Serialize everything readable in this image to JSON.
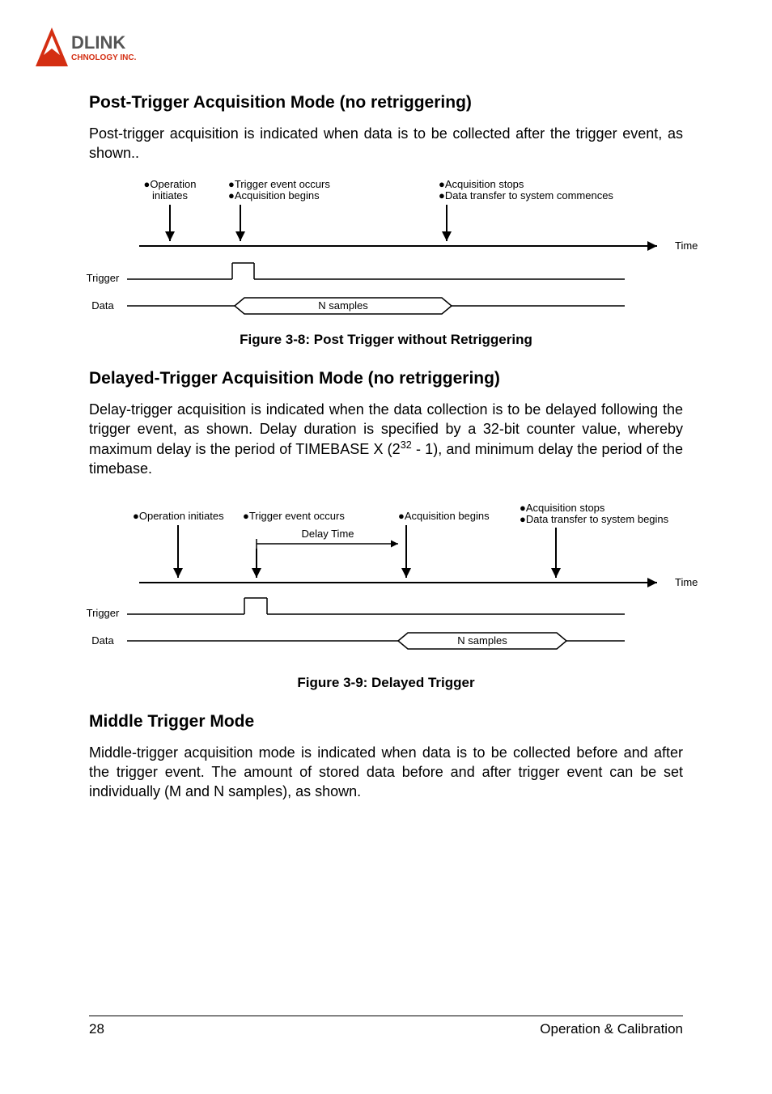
{
  "logo": {
    "brand_top": "DLINK",
    "brand_sub": "CHNOLOGY INC."
  },
  "section1": {
    "title": "Post-Trigger Acquisition Mode (no retriggering)",
    "paragraph": "Post-trigger acquisition is indicated when data is to be collected after the trigger event, as shown.."
  },
  "figure1": {
    "labels": {
      "op_init_l1": "●Operation",
      "op_init_l2": "initiates",
      "trig_occur_l1": "●Trigger event occurs",
      "trig_occur_l2": "●Acquisition begins",
      "acq_stop_l1": "●Acquisition stops",
      "acq_stop_l2": "●Data transfer to system commences",
      "time": "Time",
      "trigger": "Trigger",
      "data": "Data",
      "nsamples": "N samples"
    },
    "caption": "Figure 3-8: Post Trigger without Retriggering"
  },
  "section2": {
    "title": "Delayed-Trigger Acquisition Mode (no retriggering)",
    "para_pre": "Delay-trigger acquisition is indicated when the data collection is to be delayed following the trigger event, as shown. Delay duration is specified by a 32-bit counter value, whereby maximum delay is the period of TIMEBASE X (2",
    "para_sup": "32",
    "para_post": " - 1), and minimum delay the period of the timebase."
  },
  "figure2": {
    "labels": {
      "op_init": "●Operation initiates",
      "trig_occur": "●Trigger event occurs",
      "acq_begin": "●Acquisition begins",
      "acq_stop_l1": "●Acquisition stops",
      "acq_stop_l2": "●Data transfer to system begins",
      "delay": "Delay Time",
      "time": "Time",
      "trigger": "Trigger",
      "data": "Data",
      "nsamples": "N samples"
    },
    "caption": "Figure 3-9: Delayed Trigger"
  },
  "section3": {
    "title": "Middle Trigger Mode",
    "paragraph": "Middle-trigger acquisition mode is indicated when data is to be collected before and after the trigger event. The amount of stored data before and after trigger event can be set individually (M and N samples), as shown."
  },
  "footer": {
    "page": "28",
    "chapter": "Operation & Calibration"
  }
}
